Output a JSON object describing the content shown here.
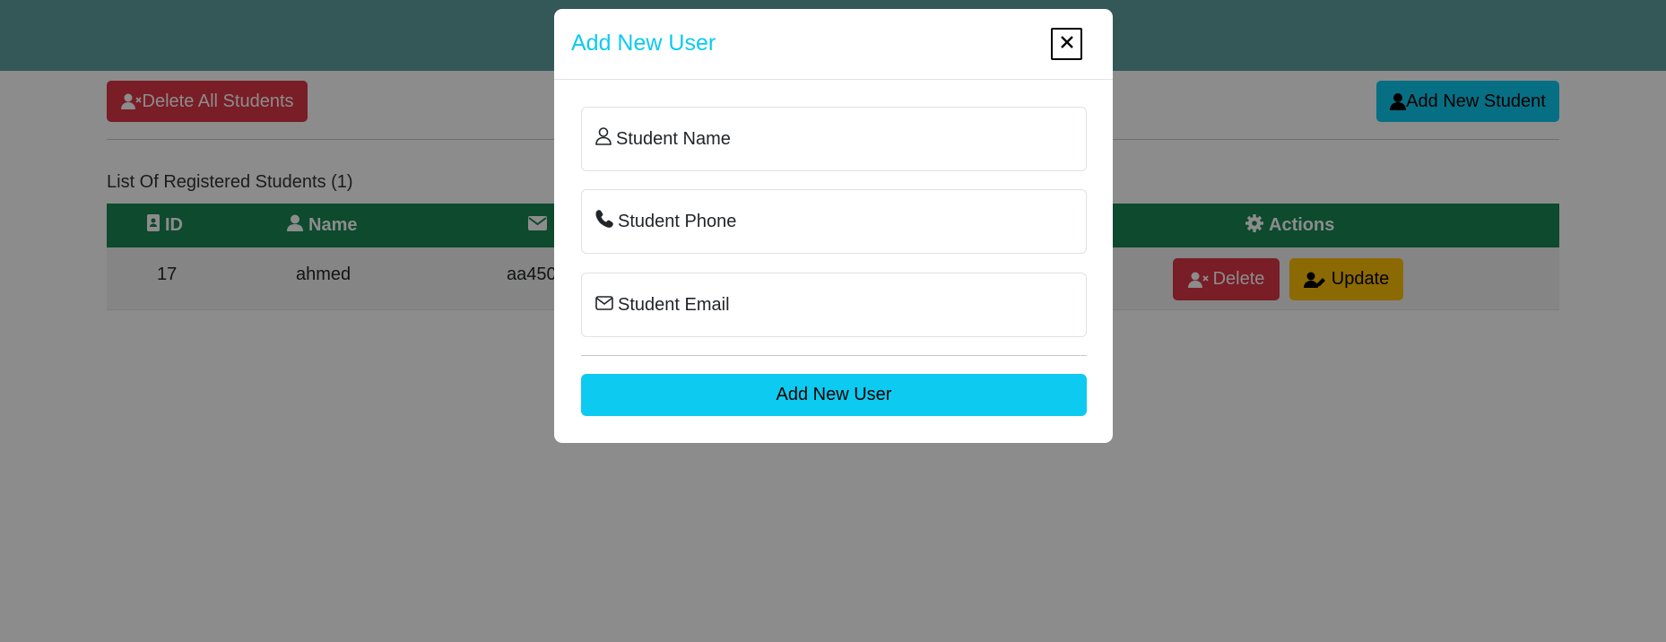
{
  "toolbar": {
    "delete_all_label": "Delete All Students",
    "add_student_label": "Add New Student"
  },
  "list": {
    "title": "List Of Registered Students (1)"
  },
  "table": {
    "headers": {
      "id": "ID",
      "name": "Name",
      "email": "",
      "actions": "Actions"
    },
    "rows": [
      {
        "id": "17",
        "name": "ahmed",
        "email": "aa450"
      }
    ],
    "delete_label": "Delete",
    "update_label": "Update"
  },
  "modal": {
    "title": "Add New User",
    "close_label": "×",
    "fields": {
      "name_placeholder": "Student Name",
      "phone_placeholder": "Student Phone",
      "email_placeholder": "Student Email"
    },
    "submit_label": "Add New User"
  },
  "colors": {
    "header_bar": "#5f9ea0",
    "danger": "#dc3545",
    "info": "#0dcaf0",
    "success": "#198754",
    "warning": "#ffc107"
  },
  "icons": {
    "delete_all": "user-xmark-icon",
    "add_student": "user-icon",
    "id_header": "id-badge-icon",
    "name_header": "user-icon",
    "email_header": "envelope-icon",
    "actions_header": "gear-icon",
    "row_delete": "user-xmark-icon",
    "row_update": "user-pen-icon",
    "field_name": "user-outline-icon",
    "field_phone": "phone-icon",
    "field_email": "envelope-outline-icon"
  }
}
